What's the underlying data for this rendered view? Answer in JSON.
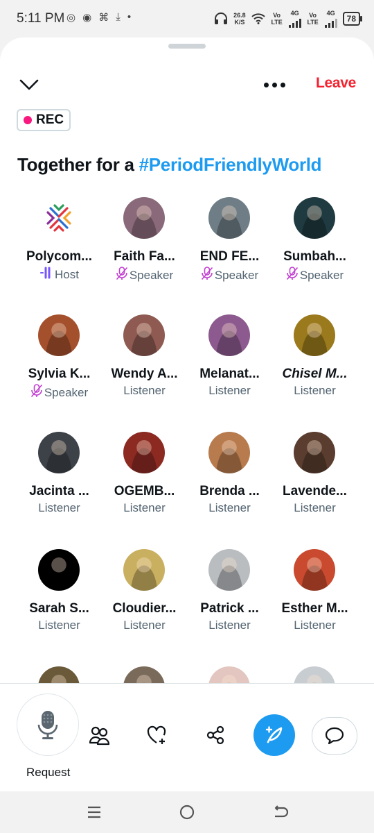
{
  "status": {
    "time": "5:11 PM",
    "net_speed": "26.8",
    "net_unit": "K/S",
    "lte1": "Vo LTE",
    "lte2": "Vo LTE",
    "net1": "4G",
    "net2": "4G",
    "battery": "78"
  },
  "header": {
    "leave_label": "Leave",
    "rec_label": "REC"
  },
  "space": {
    "title_prefix": "Together for a ",
    "title_hashtag": "#PeriodFriendlyWorld"
  },
  "participants": [
    {
      "name": "Polycom...",
      "role": "Host",
      "role_icon": "host-audio-icon",
      "avatar_color": "#ffffff"
    },
    {
      "name": "Faith Fa...",
      "role": "Speaker",
      "role_icon": "mic-muted-icon",
      "avatar_color": "#8a6a7a"
    },
    {
      "name": "END FE...",
      "role": "Speaker",
      "role_icon": "mic-muted-icon",
      "avatar_color": "#6f7e86"
    },
    {
      "name": "Sumbah...",
      "role": "Speaker",
      "role_icon": "mic-muted-icon",
      "avatar_color": "#1f3a40"
    },
    {
      "name": "Sylvia K...",
      "role": "Speaker",
      "role_icon": "mic-muted-icon",
      "avatar_color": "#a5502c"
    },
    {
      "name": "Wendy A...",
      "role": "Listener",
      "role_icon": "",
      "avatar_color": "#8e5a52"
    },
    {
      "name": "Melanat...",
      "role": "Listener",
      "role_icon": "",
      "avatar_color": "#8d5a8f"
    },
    {
      "name": "Chisel M...",
      "role": "Listener",
      "role_icon": "",
      "avatar_color": "#9a7a1c"
    },
    {
      "name": "Jacinta ...",
      "role": "Listener",
      "role_icon": "",
      "avatar_color": "#3d4248"
    },
    {
      "name": "OGEMB...",
      "role": "Listener",
      "role_icon": "",
      "avatar_color": "#8c2a22"
    },
    {
      "name": "Brenda ...",
      "role": "Listener",
      "role_icon": "",
      "avatar_color": "#b87b4d"
    },
    {
      "name": "Lavende...",
      "role": "Listener",
      "role_icon": "",
      "avatar_color": "#5a3d2e"
    },
    {
      "name": "Sarah S...",
      "role": "Listener",
      "role_icon": "",
      "avatar_color": "#000000"
    },
    {
      "name": "Cloudier...",
      "role": "Listener",
      "role_icon": "",
      "avatar_color": "#c9b060"
    },
    {
      "name": "Patrick ...",
      "role": "Listener",
      "role_icon": "",
      "avatar_color": "#b9bdc0"
    },
    {
      "name": "Esther M...",
      "role": "Listener",
      "role_icon": "",
      "avatar_color": "#c94a2e"
    },
    {
      "name": "",
      "role": "",
      "role_icon": "",
      "avatar_color": "#6b5a3a"
    },
    {
      "name": "",
      "role": "",
      "role_icon": "",
      "avatar_color": "#7a6a5a"
    },
    {
      "name": "",
      "role": "",
      "role_icon": "",
      "avatar_color": "#e2c6bf"
    },
    {
      "name": "",
      "role": "",
      "role_icon": "",
      "avatar_color": "#c8cdd2"
    }
  ],
  "bottom": {
    "request_label": "Request"
  },
  "colors": {
    "accent": "#1d9bf0",
    "leave": "#f4212e",
    "rec_dot": "#f91880",
    "muted_mic": "#c13ed0",
    "host_icon": "#7856ff"
  }
}
